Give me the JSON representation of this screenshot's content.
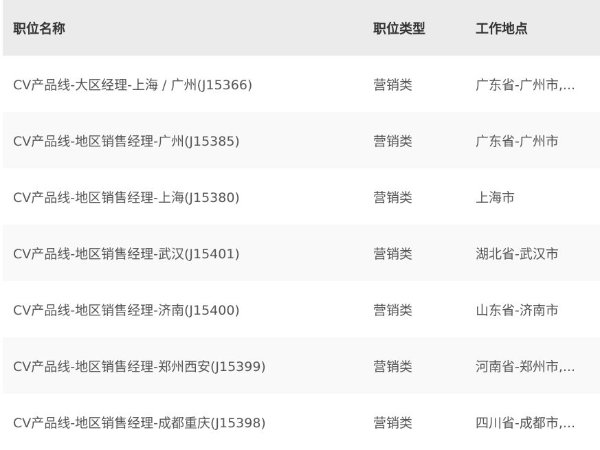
{
  "table": {
    "headers": {
      "name": "职位名称",
      "type": "职位类型",
      "location": "工作地点"
    },
    "rows": [
      {
        "name": "CV产品线-大区经理-上海 / 广州(J15366)",
        "type": "营销类",
        "location": "广东省-广州市,..."
      },
      {
        "name": "CV产品线-地区销售经理-广州(J15385)",
        "type": "营销类",
        "location": "广东省-广州市"
      },
      {
        "name": "CV产品线-地区销售经理-上海(J15380)",
        "type": "营销类",
        "location": "上海市"
      },
      {
        "name": "CV产品线-地区销售经理-武汉(J15401)",
        "type": "营销类",
        "location": "湖北省-武汉市"
      },
      {
        "name": "CV产品线-地区销售经理-济南(J15400)",
        "type": "营销类",
        "location": "山东省-济南市"
      },
      {
        "name": "CV产品线-地区销售经理-郑州西安(J15399)",
        "type": "营销类",
        "location": "河南省-郑州市,..."
      },
      {
        "name": "CV产品线-地区销售经理-成都重庆(J15398)",
        "type": "营销类",
        "location": "四川省-成都市,..."
      }
    ]
  },
  "colors": {
    "header_bg": "#ebebeb",
    "row_alt_bg": "#f9f9f9",
    "header_text": "#333333",
    "body_text": "#555555"
  }
}
